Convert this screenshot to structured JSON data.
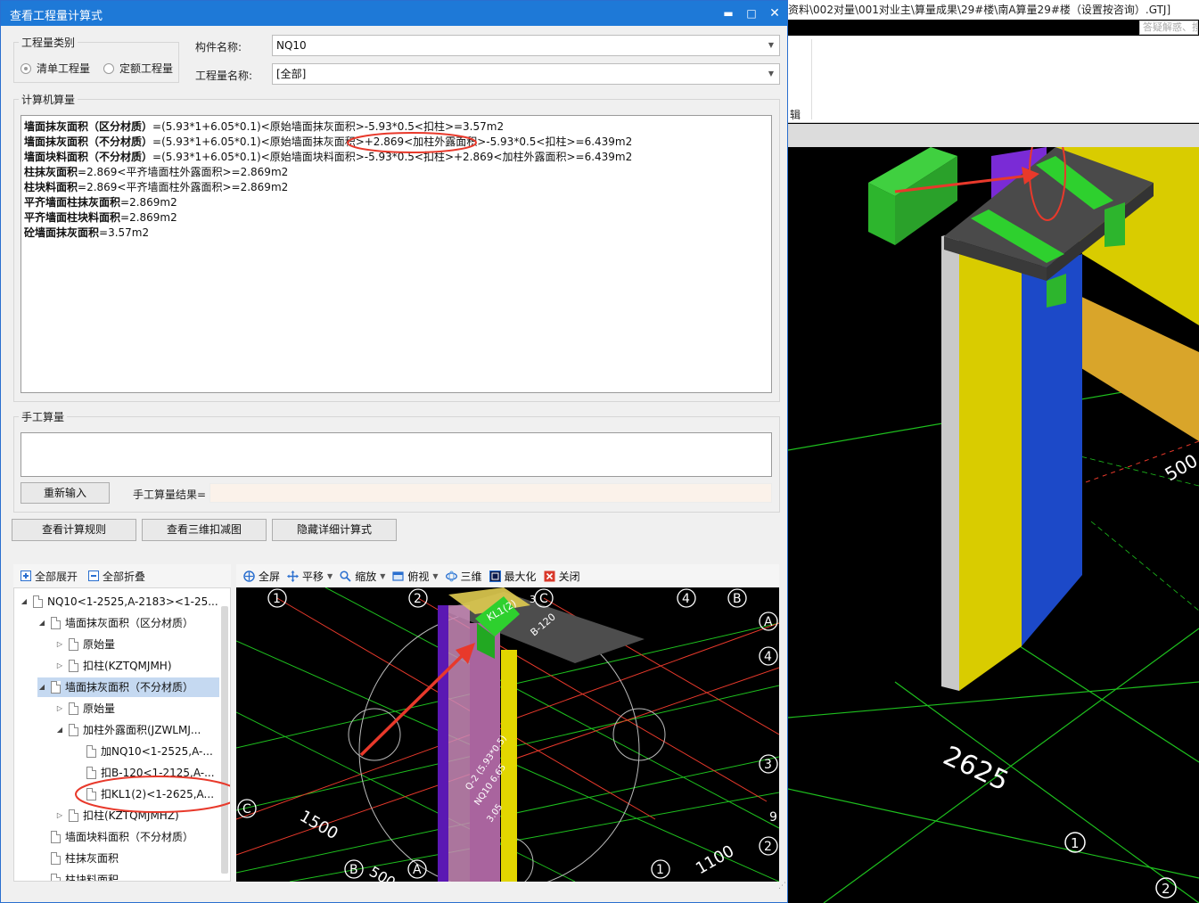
{
  "background_app": {
    "title_path": "资料\\002对量\\001对业主\\算量成果\\29#楼\\南A算量29#楼（设置按咨询）.GTJ]",
    "search_placeholder": "答疑解惑、搜",
    "ribbon_fragment": "辑",
    "viewport_labels": {
      "dim_500": "500",
      "dim_2625": "2625",
      "axis_1": "1",
      "axis_2": "2"
    },
    "colors": {
      "wall_yellow": "#d9cc00",
      "wall_blue": "#1c49c8",
      "slab_gray": "#4a4a4a",
      "beam_green": "#2db52d",
      "purple": "#7a2bd6",
      "annotation_red": "#e8392b",
      "grid_green": "#1ec01e"
    }
  },
  "dialog": {
    "title": "查看工程量计算式",
    "window_buttons": {
      "minimize": "▬",
      "maximize": "□",
      "close": "✕"
    },
    "quantity_type": {
      "group_label": "工程量类别",
      "options": [
        "清单工程量",
        "定额工程量"
      ],
      "selected": "清单工程量"
    },
    "component_name_label": "构件名称:",
    "component_name_value": "NQ10",
    "quantity_name_label": "工程量名称:",
    "quantity_name_value": "[全部]",
    "computer_calc_label": "计算机算量",
    "calc_lines": [
      {
        "name": "墙面抹灰面积（区分材质）",
        "formula": "=(5.93*1+6.05*0.1)<原始墙面抹灰面积>-5.93*0.5<扣柱>=3.57m2"
      },
      {
        "name": "墙面抹灰面积（不分材质）",
        "formula": "=(5.93*1+6.05*0.1)<原始墙面抹灰面积>+2.869<加柱外露面积>-5.93*0.5<扣柱>=6.439m2"
      },
      {
        "name": "墙面块料面积（不分材质）",
        "formula": "=(5.93*1+6.05*0.1)<原始墙面块料面积>-5.93*0.5<扣柱>+2.869<加柱外露面积>=6.439m2"
      },
      {
        "name": "柱抹灰面积",
        "formula": "=2.869<平齐墙面柱外露面积>=2.869m2"
      },
      {
        "name": "柱块料面积",
        "formula": "=2.869<平齐墙面柱外露面积>=2.869m2"
      },
      {
        "name": "平齐墙面柱抹灰面积",
        "formula": "=2.869m2"
      },
      {
        "name": "平齐墙面柱块料面积",
        "formula": "=2.869m2"
      },
      {
        "name": "砼墙面抹灰面积",
        "formula": "=3.57m2"
      }
    ],
    "manual_calc_label": "手工算量",
    "reenter_button": "重新输入",
    "manual_result_label": "手工算量结果=",
    "view_rules_button": "查看计算规则",
    "view_3d_button": "查看三维扣减图",
    "hide_detail_button": "隐藏详细计算式"
  },
  "tree_toolbar": {
    "expand_all": "全部展开",
    "collapse_all": "全部折叠"
  },
  "tree": [
    {
      "label": "NQ10<1-2525,A-2183><1-25...",
      "level": 0,
      "expander": "◢"
    },
    {
      "label": "墙面抹灰面积（区分材质）",
      "level": 1,
      "expander": "◢"
    },
    {
      "label": "原始量",
      "level": 2,
      "expander": "▷"
    },
    {
      "label": "扣柱(KZTQMJMH)",
      "level": 2,
      "expander": "▷"
    },
    {
      "label": "墙面抹灰面积（不分材质）",
      "level": 1,
      "expander": "◢",
      "selected": true
    },
    {
      "label": "原始量",
      "level": 2,
      "expander": "▷"
    },
    {
      "label": "加柱外露面积(JZWLMJ...",
      "level": 2,
      "expander": "◢"
    },
    {
      "label": "加NQ10<1-2525,A-...",
      "level": 3,
      "expander": ""
    },
    {
      "label": "扣B-120<1-2125,A-...",
      "level": 3,
      "expander": ""
    },
    {
      "label": "扣KL1(2)<1-2625,A...",
      "level": 3,
      "expander": ""
    },
    {
      "label": "扣柱(KZTQMJMHZ)",
      "level": 2,
      "expander": "▷"
    },
    {
      "label": "墙面块料面积（不分材质）",
      "level": 1,
      "expander": ""
    },
    {
      "label": "柱抹灰面积",
      "level": 1,
      "expander": ""
    },
    {
      "label": "柱块料面积",
      "level": 1,
      "expander": ""
    }
  ],
  "viewer_toolbar": {
    "fullscreen": "全屏",
    "pan": "平移",
    "zoom": "缩放",
    "top_view": "俯视",
    "three_d": "三维",
    "maximize": "最大化",
    "close": "关闭"
  },
  "viewer_labels": {
    "axis_1": "1",
    "axis_2": "2",
    "axis_3": "3",
    "axis_4": "4",
    "axis_A": "A",
    "axis_B": "B",
    "axis_C": "C",
    "dim_1500": "1500",
    "dim_1100": "1100",
    "dim_500": "500",
    "dim_9": "9",
    "beam_tag": "KL1(2)",
    "slab_tag": "B-120",
    "tag_3": "3",
    "wall_tag_1": "Q-2 (5.93*0.5)",
    "wall_tag_2": "NQ10 6.65",
    "wall_tag_3": "3.05"
  }
}
